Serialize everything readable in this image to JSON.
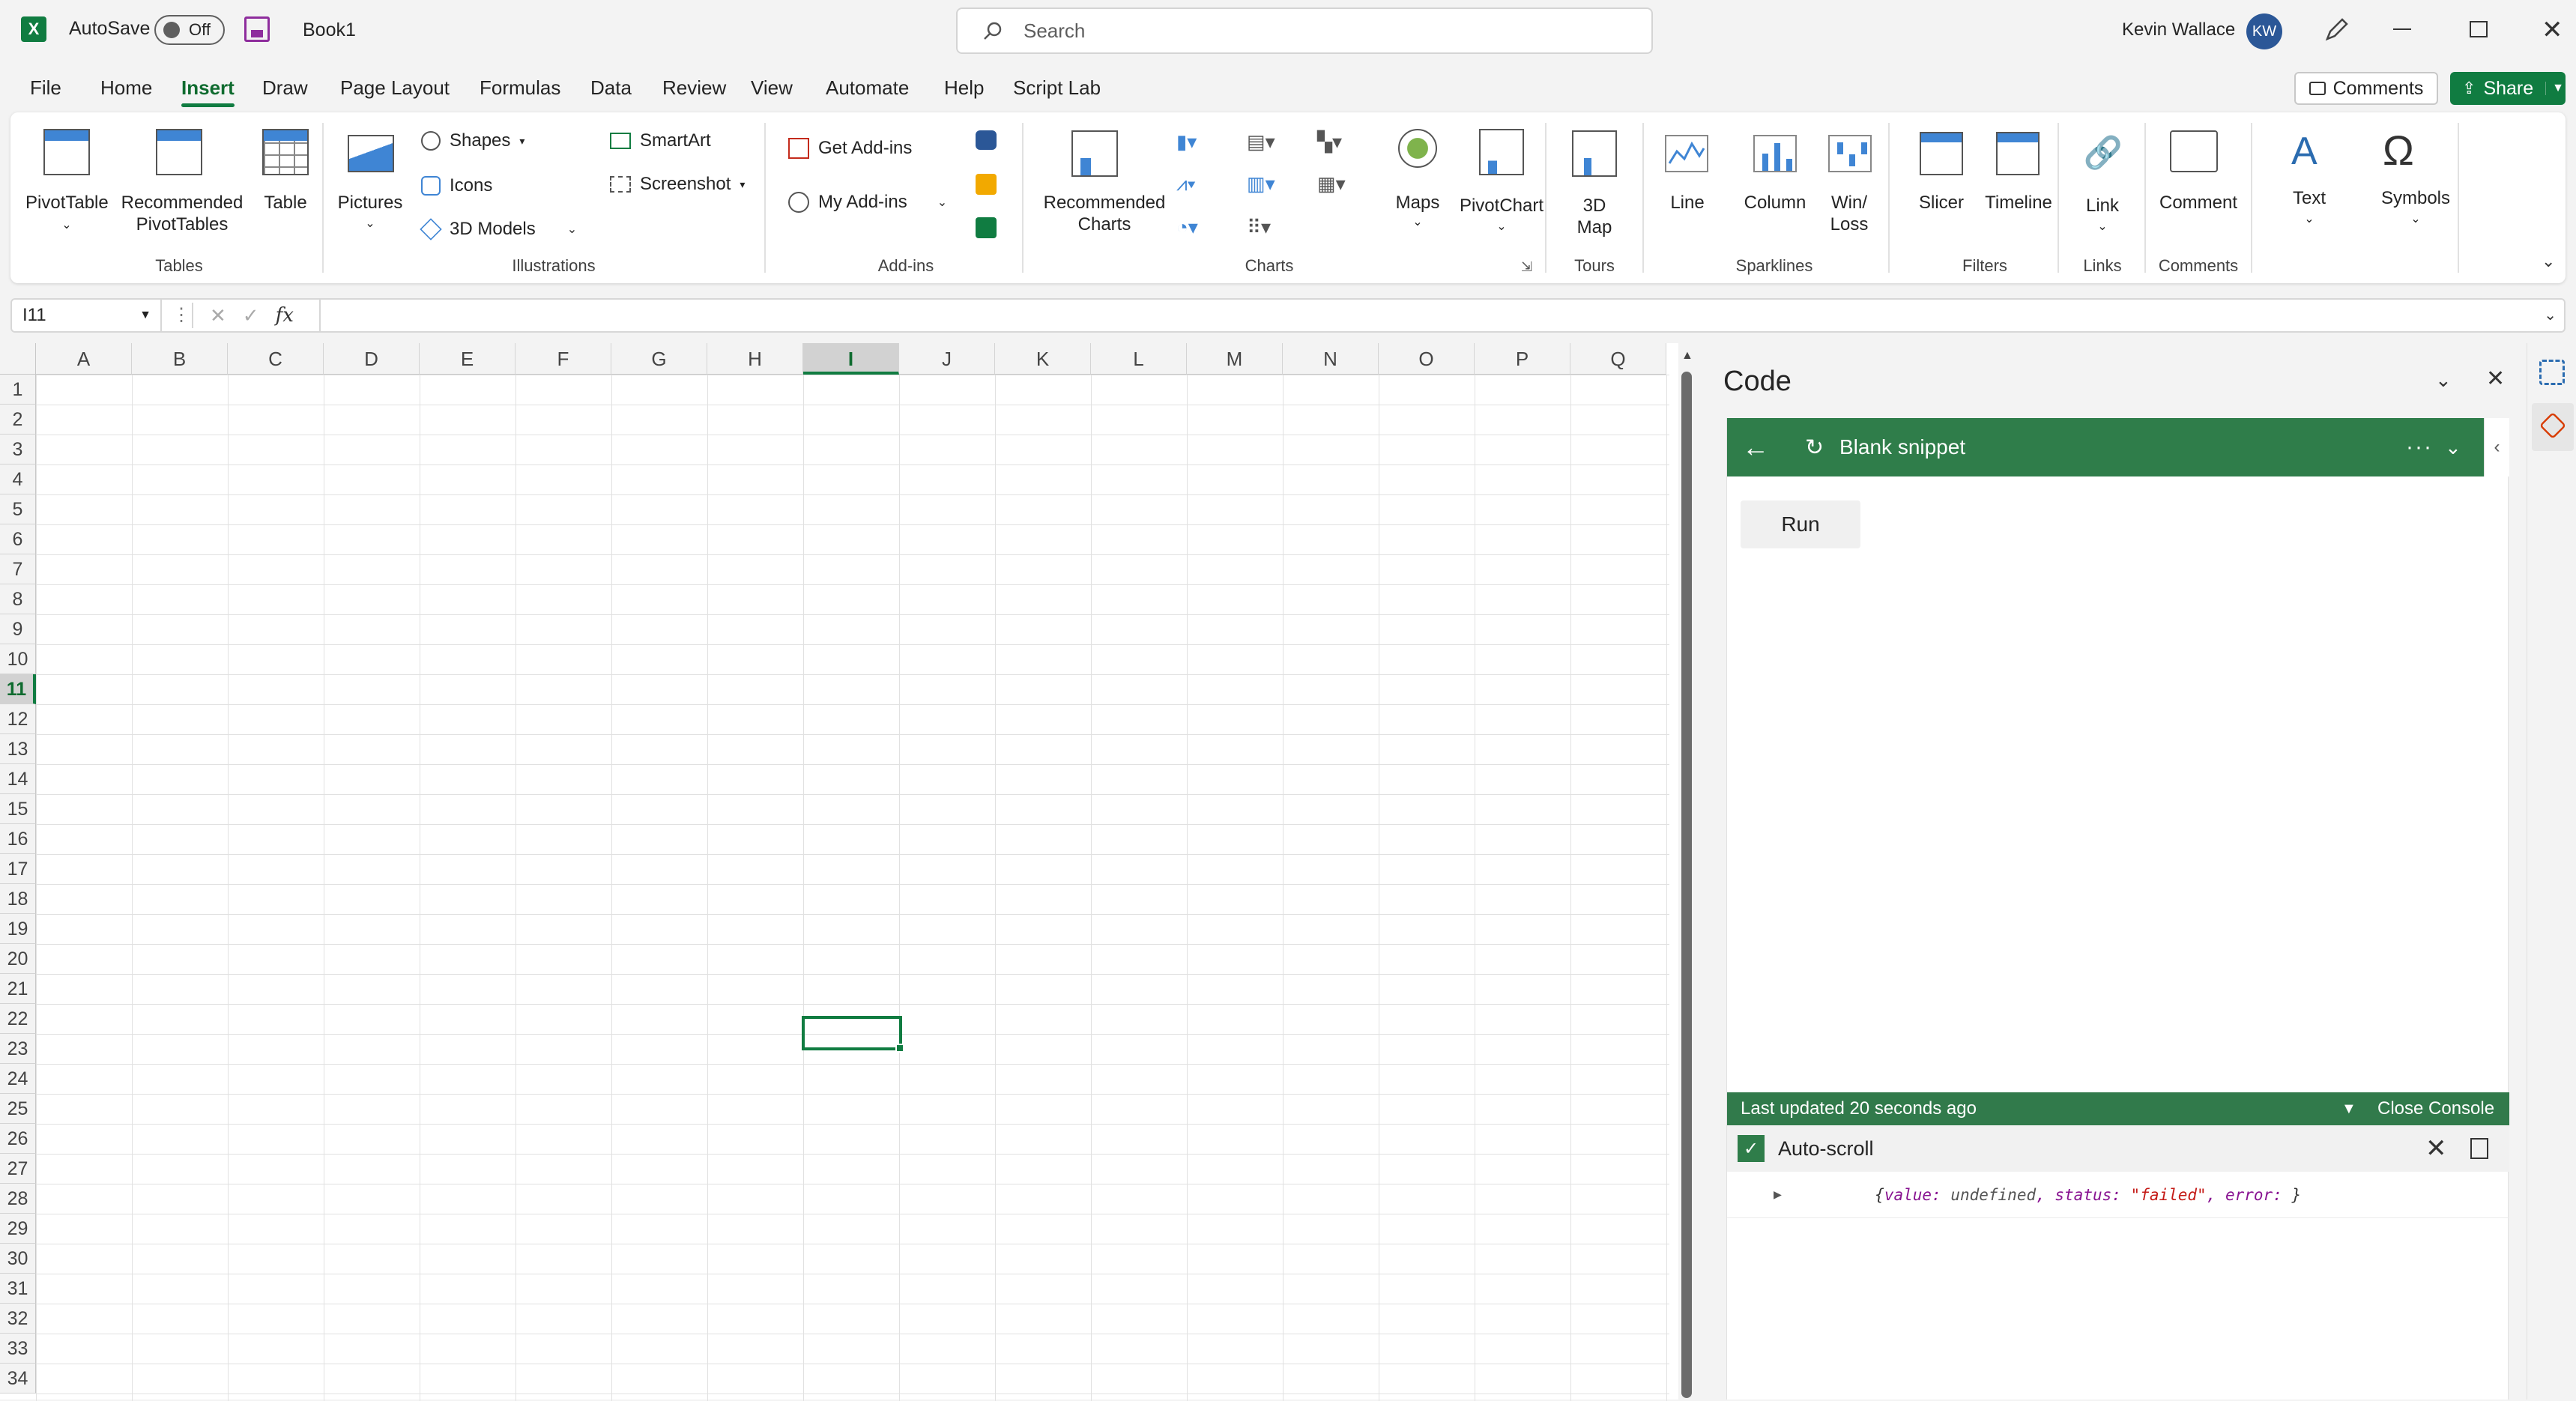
{
  "titlebar": {
    "autosave_label": "AutoSave",
    "autosave_state": "Off",
    "doc_name": "Book1",
    "search_placeholder": "Search",
    "user_name": "Kevin Wallace",
    "user_initials": "KW"
  },
  "menu": {
    "items": [
      "File",
      "Home",
      "Insert",
      "Draw",
      "Page Layout",
      "Formulas",
      "Data",
      "Review",
      "View",
      "Automate",
      "Help",
      "Script Lab"
    ],
    "active": "Insert",
    "comments_label": "Comments",
    "share_label": "Share"
  },
  "ribbon": {
    "pivottable": "PivotTable",
    "recommended_pivottables_1": "Recommended",
    "recommended_pivottables_2": "PivotTables",
    "table": "Table",
    "group_tables": "Tables",
    "pictures": "Pictures",
    "shapes": "Shapes",
    "icons": "Icons",
    "models_3d": "3D Models",
    "smartart": "SmartArt",
    "screenshot": "Screenshot",
    "group_illustrations": "Illustrations",
    "get_addins": "Get Add-ins",
    "my_addins": "My Add-ins",
    "group_addins": "Add-ins",
    "recommended_charts_1": "Recommended",
    "recommended_charts_2": "Charts",
    "maps": "Maps",
    "pivotchart": "PivotChart",
    "group_charts": "Charts",
    "map3d_1": "3D",
    "map3d_2": "Map",
    "group_tours": "Tours",
    "line": "Line",
    "column": "Column",
    "winloss_1": "Win/",
    "winloss_2": "Loss",
    "group_sparklines": "Sparklines",
    "slicer": "Slicer",
    "timeline": "Timeline",
    "group_filters": "Filters",
    "link": "Link",
    "group_links": "Links",
    "comment": "Comment",
    "group_comments": "Comments",
    "text": "Text",
    "symbols": "Symbols"
  },
  "formula_bar": {
    "name_box": "I11",
    "fx": "fx",
    "value": ""
  },
  "grid": {
    "columns": [
      "A",
      "B",
      "C",
      "D",
      "E",
      "F",
      "G",
      "H",
      "I",
      "J",
      "K",
      "L",
      "M",
      "N",
      "O",
      "P",
      "Q"
    ],
    "rows": [
      "1",
      "2",
      "3",
      "4",
      "5",
      "6",
      "7",
      "8",
      "9",
      "10",
      "11",
      "12",
      "13",
      "14",
      "15",
      "16",
      "17",
      "18",
      "19",
      "20",
      "21",
      "22",
      "23",
      "24",
      "25",
      "26",
      "27",
      "28",
      "29",
      "30",
      "31",
      "32",
      "33",
      "34"
    ],
    "selected_col": "I",
    "selected_row": "11"
  },
  "pane": {
    "title": "Code",
    "snippet_name": "Blank snippet",
    "run_label": "Run",
    "console_status": "Last updated 20 seconds ago",
    "close_console": "Close Console",
    "autoscroll_label": "Auto-scroll",
    "log_open": "{",
    "log_k1": "value:",
    "log_v1": " undefined",
    "log_k2": ", status: ",
    "log_v2": "\"failed\"",
    "log_k3": ", error: ",
    "log_close": "}"
  },
  "colors": {
    "excel_green": "#107c41",
    "pane_green": "#2f7d4a",
    "console_green": "#317a4b"
  }
}
